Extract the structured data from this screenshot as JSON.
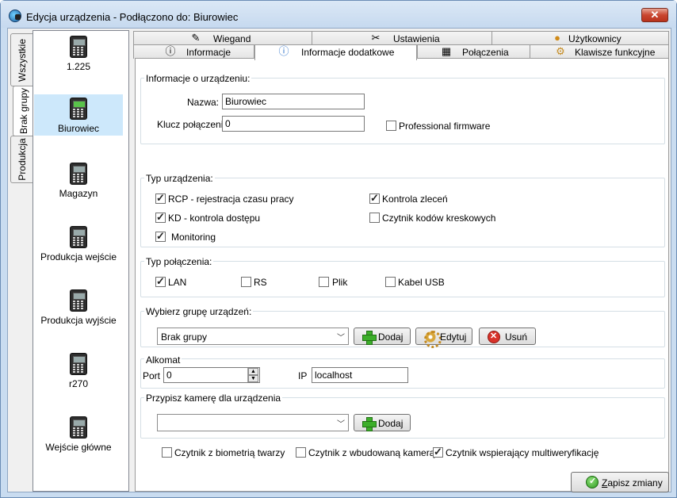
{
  "window": {
    "title": "Edycja urządzenia - Podłączono do: Biurowiec",
    "close_label": "✕"
  },
  "side_tabs": [
    {
      "label": "Wszystkie",
      "active": false
    },
    {
      "label": "Brak grupy",
      "active": true
    },
    {
      "label": "Produkcja",
      "active": false
    }
  ],
  "devices": [
    {
      "label": "1.225",
      "selected": false
    },
    {
      "label": "Biurowiec",
      "selected": true
    },
    {
      "label": "Magazyn",
      "selected": false
    },
    {
      "label": "Produkcja wejście",
      "selected": false
    },
    {
      "label": "Produkcja wyjście",
      "selected": false
    },
    {
      "label": "r270",
      "selected": false
    },
    {
      "label": "Wejście główne",
      "selected": false
    }
  ],
  "tabs": {
    "row1": [
      {
        "label": "Wiegand",
        "icon": "wiegand-icon"
      },
      {
        "label": "Ustawienia",
        "icon": "tools-icon"
      },
      {
        "label": "Użytkownicy",
        "icon": "user-icon"
      }
    ],
    "row2": [
      {
        "label": "Informacje",
        "icon": "info-icon"
      },
      {
        "label": "Informacje dodatkowe",
        "icon": "info-blue-icon",
        "active": true
      },
      {
        "label": "Połączenia",
        "icon": "network-icon"
      },
      {
        "label": "Klawisze funkcyjne",
        "icon": "gear-icon"
      }
    ]
  },
  "device_info": {
    "legend": "Informacje o urządzeniu:",
    "name_label": "Nazwa:",
    "name_value": "Biurowiec",
    "key_label": "Klucz połączenia",
    "key_value": "0",
    "professional_label": "Professional firmware",
    "professional_checked": false
  },
  "device_type": {
    "legend": "Typ urządzenia:",
    "rcp_label": "RCP - rejestracja czasu pracy",
    "kd_label": "KD - kontrola dostępu",
    "monitoring_label": "Monitoring",
    "orders_label": "Kontrola zleceń",
    "barcode_label": "Czytnik kodów kreskowych"
  },
  "connection_type": {
    "legend": "Typ połączenia:",
    "lan_label": "LAN",
    "rs_label": "RS",
    "file_label": "Plik",
    "usb_label": "Kabel USB"
  },
  "device_group": {
    "legend": "Wybierz grupę urządzeń:",
    "selected": "Brak grupy",
    "add_label": "Dodaj",
    "edit_label": "Edytuj",
    "delete_label": "Usuń"
  },
  "alcohol": {
    "legend": "Alkomat",
    "port_label": "Port",
    "port_value": "0",
    "ip_label": "IP",
    "ip_value": "localhost"
  },
  "camera": {
    "legend": "Przypisz kamerę dla urządzenia",
    "selected": "",
    "add_label": "Dodaj"
  },
  "readers": {
    "face_label": "Czytnik z biometrią twarzy",
    "camera_label": "Czytnik z wbudowaną kamerą",
    "mfa_label": "Czytnik wspierający multiweryfikację"
  },
  "save_label": "Zapisz zmiany",
  "colors": {
    "title_bar": "#c9dcf0",
    "selected_item": "#cde8fb",
    "close_button": "#c9452f"
  }
}
